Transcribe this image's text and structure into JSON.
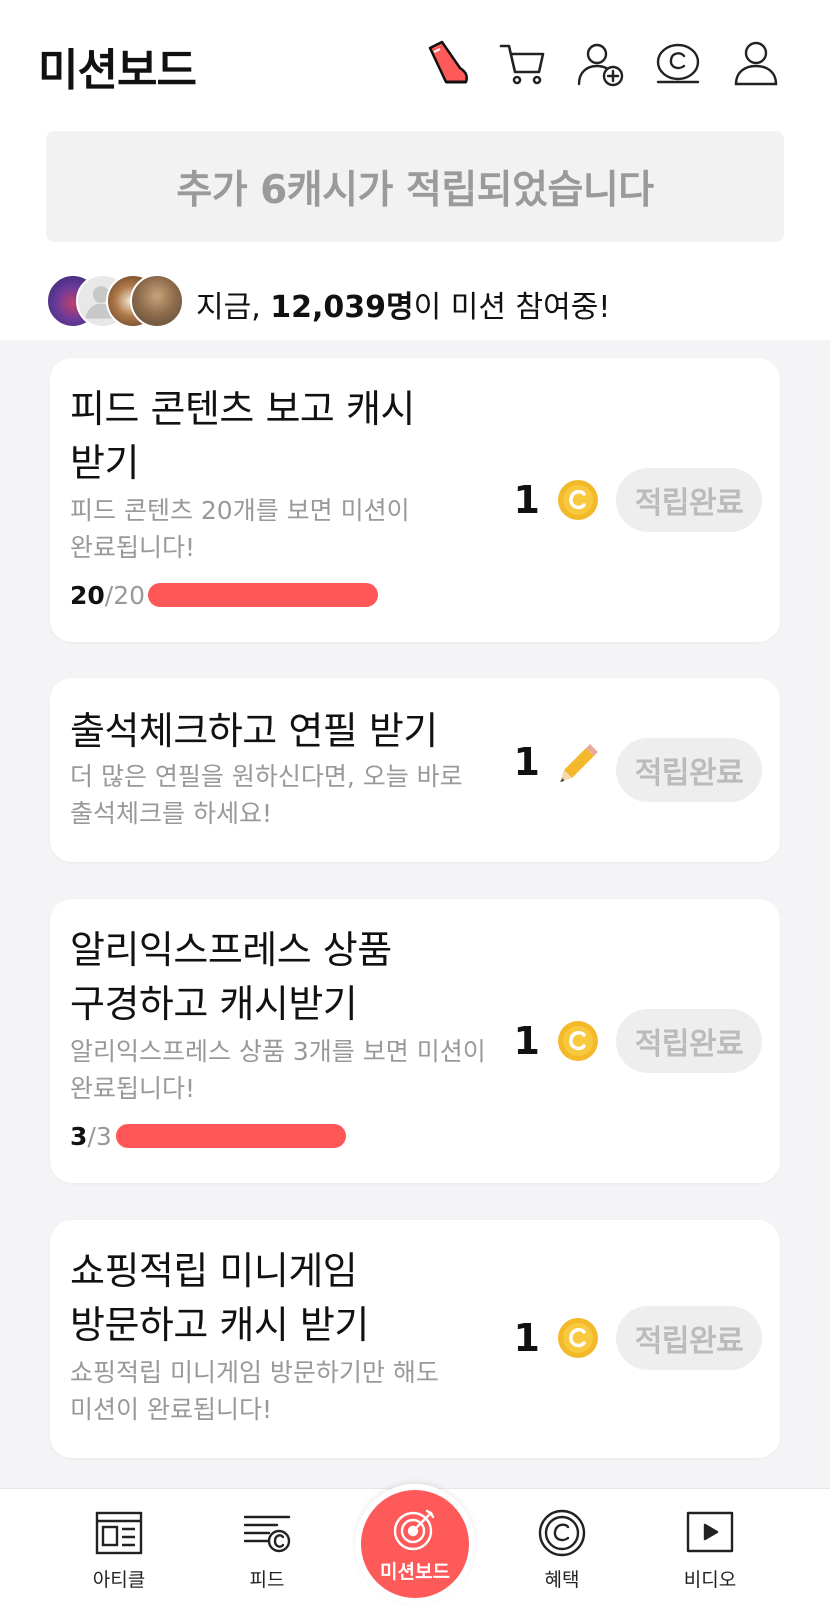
{
  "header": {
    "title": "미션보드",
    "icons": [
      "shoe-walk-icon",
      "cart-icon",
      "add-friend-icon",
      "cash-coin-icon",
      "profile-icon"
    ]
  },
  "banner": {
    "text": "추가 6캐시가 적립되었습니다"
  },
  "participants": {
    "prefix": "지금, ",
    "count": "12,039명",
    "suffix": "이 미션 참여중!"
  },
  "missions": [
    {
      "title_line1": "피드 콘텐츠 보고 캐시",
      "title_line2": "받기",
      "desc_line1": "피드 콘텐츠 20개를 보면 미션이",
      "desc_line2": "완료됩니다!",
      "progress_current": "20",
      "progress_total": "/20",
      "progress_fraction": 1.0,
      "reward": "1",
      "reward_icon": "cash-coin-icon",
      "button": "적립완료"
    },
    {
      "title_line1": "출석체크하고 연필 받기",
      "desc_line1": "더 많은 연필을 원하신다면, 오늘 바로",
      "desc_line2": "출석체크를 하세요!",
      "reward": "1",
      "reward_icon": "pencil-icon",
      "button": "적립완료"
    },
    {
      "title_line1": "알리익스프레스 상품",
      "title_line2": "구경하고 캐시받기",
      "desc_line1": "알리익스프레스 상품 3개를 보면 미션이",
      "desc_line2": "완료됩니다!",
      "progress_current": "3",
      "progress_total": "/3",
      "progress_fraction": 1.0,
      "reward": "1",
      "reward_icon": "cash-coin-icon",
      "button": "적립완료"
    },
    {
      "title_line1": "쇼핑적립 미니게임",
      "title_line2": "방문하고 캐시 받기",
      "desc_line1": "쇼핑적립 미니게임 방문하기만 해도",
      "desc_line2": "미션이 완료됩니다!",
      "reward": "1",
      "reward_icon": "cash-coin-icon",
      "button": "적립완료"
    }
  ],
  "bottom_nav": {
    "items": [
      {
        "label": "아티클",
        "icon": "article-icon"
      },
      {
        "label": "피드",
        "icon": "feed-icon"
      },
      {
        "label": "미션보드",
        "icon": "target-icon"
      },
      {
        "label": "혜택",
        "icon": "benefit-coin-icon"
      },
      {
        "label": "비디오",
        "icon": "video-icon"
      }
    ]
  },
  "colors": {
    "accent": "#ff5757",
    "coin": "#f4b92a",
    "muted_text": "#999999",
    "button_bg": "#eeeeee",
    "button_text": "#bbbbbb"
  }
}
